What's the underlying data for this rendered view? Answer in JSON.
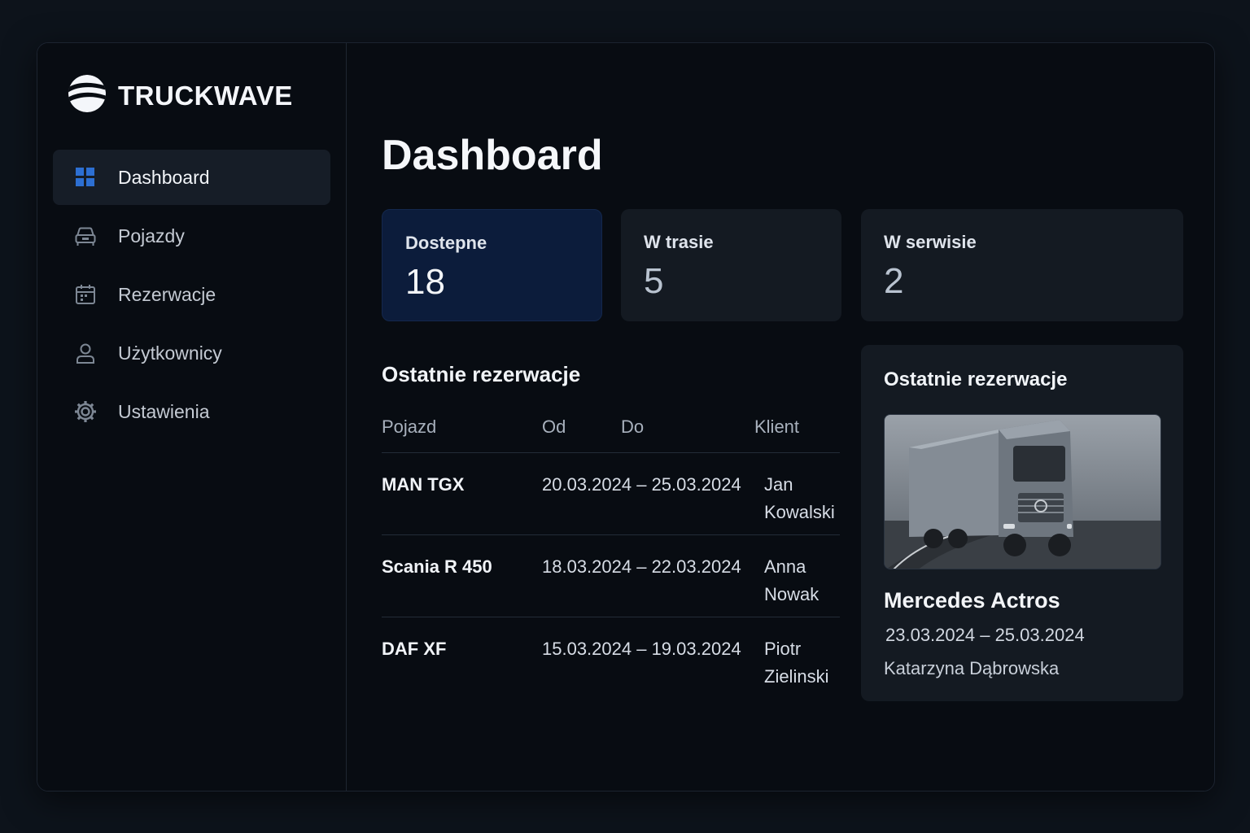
{
  "brand": {
    "name": "TRUCKWAVE"
  },
  "sidebar": {
    "items": [
      {
        "label": "Dashboard",
        "icon": "grid-icon",
        "active": true
      },
      {
        "label": "Pojazdy",
        "icon": "car-icon"
      },
      {
        "label": "Rezerwacje",
        "icon": "calendar-icon"
      },
      {
        "label": "Użytkownicy",
        "icon": "user-icon"
      },
      {
        "label": "Ustawienia",
        "icon": "gear-icon"
      }
    ]
  },
  "page": {
    "title": "Dashboard"
  },
  "stats": [
    {
      "label": "Dostepne",
      "value": "18"
    },
    {
      "label": "W trasie",
      "value": "5"
    },
    {
      "label": "W serwisie",
      "value": "2"
    }
  ],
  "recent": {
    "title": "Ostatnie rezerwacje",
    "columns": {
      "vehicle": "Pojazd",
      "from": "Od",
      "to": "Do",
      "client": "Klient"
    },
    "rows": [
      {
        "vehicle": "MAN TGX",
        "dates": "20.03.2024 – 25.03.2024",
        "client": "Jan Kowalski"
      },
      {
        "vehicle": "Scania R 450",
        "dates": "18.03.2024 – 22.03.2024",
        "client": "Anna Nowak"
      },
      {
        "vehicle": "DAF XF",
        "dates": "15.03.2024 – 19.03.2024",
        "client": "Piotr Zielinski"
      }
    ]
  },
  "featured": {
    "title": "Ostatnie rezerwacje",
    "image_icon": "truck-image",
    "vehicle": "Mercedes Actros",
    "dates": "23.03.2024 – 25.03.2024",
    "client": "Katarzyna Dąbrowska"
  },
  "colors": {
    "background": "#0d131b",
    "panel": "#080c12",
    "card": "#141a22",
    "highlight_card": "#0c1c3b",
    "accent": "#2d6fd2"
  }
}
